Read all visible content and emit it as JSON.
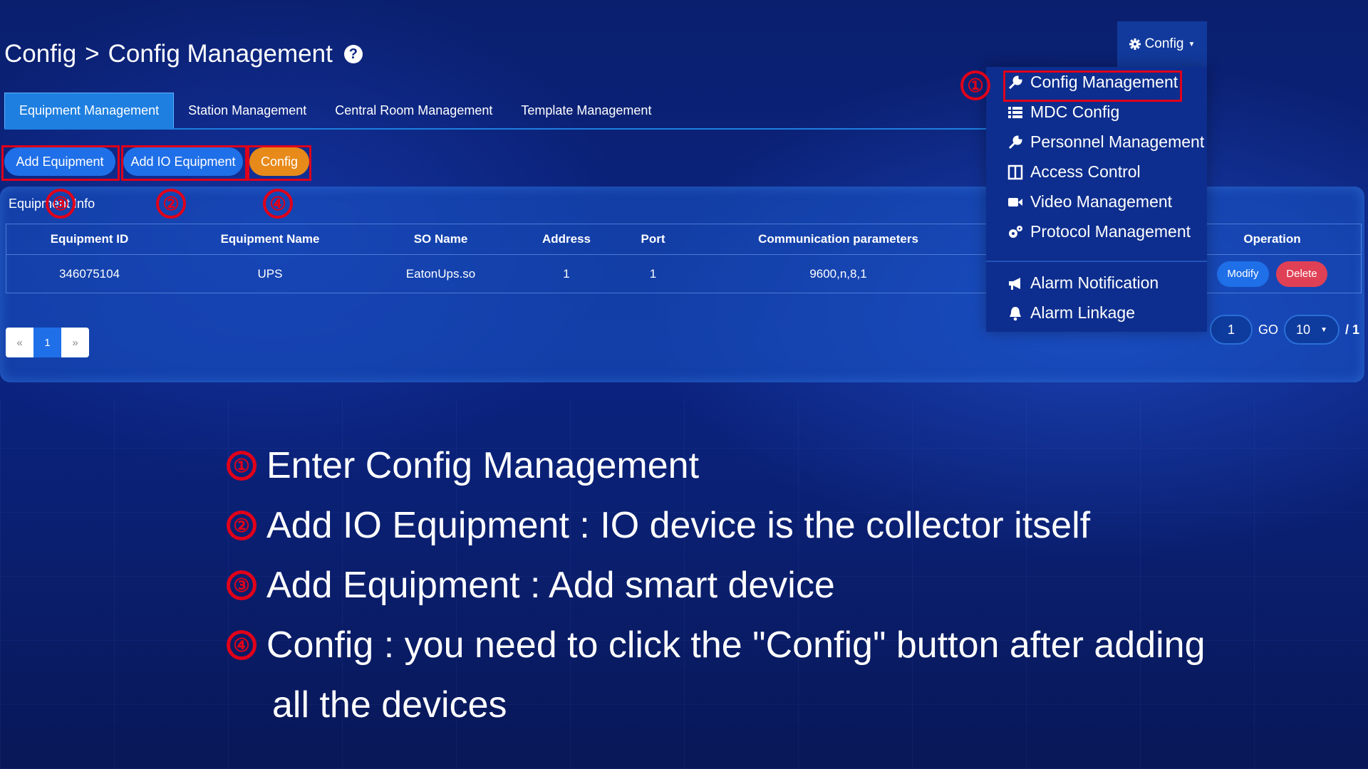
{
  "breadcrumb": {
    "root": "Config",
    "separator": ">",
    "current": "Config Management",
    "help_icon": "?"
  },
  "tabs": [
    {
      "label": "Equipment Management",
      "active": true
    },
    {
      "label": "Station Management",
      "active": false
    },
    {
      "label": "Central Room Management",
      "active": false
    },
    {
      "label": "Template Management",
      "active": false
    }
  ],
  "toolbar": {
    "add_equipment": "Add Equipment",
    "add_io_equipment": "Add IO Equipment",
    "config": "Config"
  },
  "panel": {
    "title": "Equipment Info"
  },
  "table": {
    "headers": [
      "Equipment ID",
      "Equipment Name",
      "SO Name",
      "Address",
      "Port",
      "Communication parameters",
      "",
      "Operation"
    ],
    "rows": [
      {
        "id": "346075104",
        "name": "UPS",
        "so": "EatonUps.so",
        "address": "1",
        "port": "1",
        "comm": "9600,n,8,1",
        "extra": "",
        "modify": "Modify",
        "delete": "Delete"
      }
    ]
  },
  "pager": {
    "prev": "«",
    "current": "1",
    "next": "»",
    "page_input": "1",
    "go": "GO",
    "page_size": "10",
    "total": "/ 1"
  },
  "dropdown": {
    "label": "Config",
    "items": [
      {
        "label": "Config Management",
        "icon": "wrench-icon"
      },
      {
        "label": "MDC Config",
        "icon": "list-icon"
      },
      {
        "label": "Personnel Management",
        "icon": "wrench-icon"
      },
      {
        "label": "Access Control",
        "icon": "door-icon"
      },
      {
        "label": "Video Management",
        "icon": "video-camera-icon"
      },
      {
        "label": "Protocol Management",
        "icon": "gears-icon"
      },
      {
        "label": "Alarm Notification",
        "icon": "megaphone-icon"
      },
      {
        "label": "Alarm Linkage",
        "icon": "bell-icon"
      }
    ]
  },
  "markers": {
    "m1": "①",
    "m2": "②",
    "m3": "③",
    "m4": "④"
  },
  "steps": {
    "s1": {
      "num": "①",
      "text": "Enter Config Management"
    },
    "s2": {
      "num": "②",
      "text": "Add IO Equipment : IO device is the collector itself"
    },
    "s3": {
      "num": "③",
      "text": "Add Equipment : Add smart device"
    },
    "s4": {
      "num": "④",
      "text": "Config : you need to click the \"Config\" button after adding"
    },
    "s4b": {
      "text": "all the devices"
    }
  },
  "colors": {
    "accent": "#1f6fe8",
    "config_button": "#e88a1a",
    "delete_button": "#e04055",
    "annotation_red": "#e0001a"
  }
}
